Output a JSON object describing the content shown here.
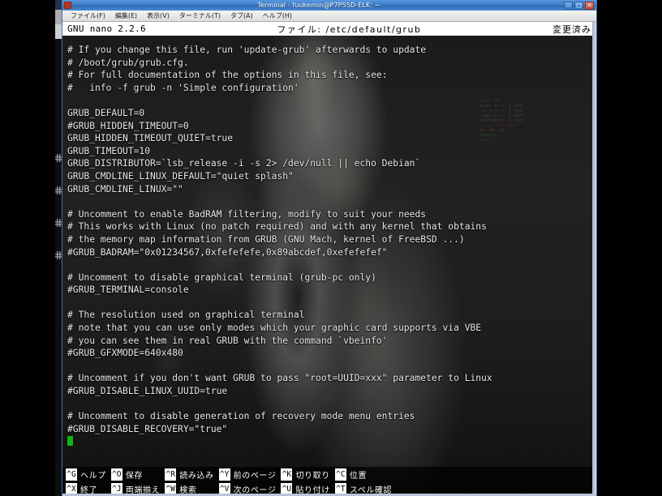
{
  "window": {
    "title": "Terminal - fuukemin@P7P55D-ELK: ~",
    "icon": "terminal-icon",
    "buttons": {
      "minimize": "–",
      "maximize": "□",
      "close": "✕"
    }
  },
  "menubar": {
    "items": [
      {
        "label": "ファイル(F)",
        "name": "menu-file"
      },
      {
        "label": "編集(E)",
        "name": "menu-edit"
      },
      {
        "label": "表示(V)",
        "name": "menu-view"
      },
      {
        "label": "ターミナル(T)",
        "name": "menu-terminal"
      },
      {
        "label": "タブ(A)",
        "name": "menu-tab"
      },
      {
        "label": "ヘルプ(H)",
        "name": "menu-help"
      }
    ]
  },
  "nano": {
    "version": "GNU nano 2.2.6",
    "file_label": "ファイル: /etc/default/grub",
    "modified": "変更済み",
    "lines": [
      "# If you change this file, run 'update-grub' afterwards to update",
      "# /boot/grub/grub.cfg.",
      "# For full documentation of the options in this file, see:",
      "#   info -f grub -n 'Simple configuration'",
      "",
      "GRUB_DEFAULT=0",
      "#GRUB_HIDDEN_TIMEOUT=0",
      "GRUB_HIDDEN_TIMEOUT_QUIET=true",
      "GRUB_TIMEOUT=10",
      "GRUB_DISTRIBUTOR=`lsb_release -i -s 2> /dev/null || echo Debian`",
      "GRUB_CMDLINE_LINUX_DEFAULT=\"quiet splash\"",
      "GRUB_CMDLINE_LINUX=\"\"",
      "",
      "# Uncomment to enable BadRAM filtering, modify to suit your needs",
      "# This works with Linux (no patch required) and with any kernel that obtains",
      "# the memory map information from GRUB (GNU Mach, kernel of FreeBSD ...)",
      "#GRUB_BADRAM=\"0x01234567,0xfefefefe,0x89abcdef,0xefefefef\"",
      "",
      "# Uncomment to disable graphical terminal (grub-pc only)",
      "#GRUB_TERMINAL=console",
      "",
      "# The resolution used on graphical terminal",
      "# note that you can use only modes which your graphic card supports via VBE",
      "# you can see them in real GRUB with the command `vbeinfo'",
      "#GRUB_GFXMODE=640x480",
      "",
      "# Uncomment if you don't want GRUB to pass \"root=UUID=xxx\" parameter to Linux",
      "#GRUB_DISABLE_LINUX_UUID=true",
      "",
      "# Uncomment to disable generation of recovery mode menu entries",
      "#GRUB_DISABLE_RECOVERY=\"true\""
    ],
    "cursor_line_index": 30,
    "cursor_color": "#17b317"
  },
  "shortcuts": {
    "columns": [
      {
        "rows": [
          {
            "key": "^G",
            "label": "ヘルプ",
            "name": "shortcut-help"
          },
          {
            "key": "^X",
            "label": "終了",
            "name": "shortcut-exit"
          }
        ]
      },
      {
        "rows": [
          {
            "key": "^O",
            "label": "保存",
            "name": "shortcut-save"
          },
          {
            "key": "^J",
            "label": "両端揃え",
            "name": "shortcut-justify"
          }
        ]
      },
      {
        "rows": [
          {
            "key": "^R",
            "label": "読み込み",
            "name": "shortcut-read-file"
          },
          {
            "key": "^W",
            "label": "検索",
            "name": "shortcut-search"
          }
        ]
      },
      {
        "rows": [
          {
            "key": "^Y",
            "label": "前のページ",
            "name": "shortcut-prev-page"
          },
          {
            "key": "^V",
            "label": "次のページ",
            "name": "shortcut-next-page"
          }
        ]
      },
      {
        "rows": [
          {
            "key": "^K",
            "label": "切り取り",
            "name": "shortcut-cut"
          },
          {
            "key": "^U",
            "label": "貼り付け",
            "name": "shortcut-paste"
          }
        ]
      },
      {
        "rows": [
          {
            "key": "^C",
            "label": "位置",
            "name": "shortcut-cur-pos"
          },
          {
            "key": "^T",
            "label": "スペル確認",
            "name": "shortcut-spell"
          }
        ]
      }
    ]
  },
  "ghost_session": {
    "lines": [
      "total 48",
      "drwxr-xr-x  2 root",
      "-rw-r--r--  1 root",
      "-rwxr-xr-x  1 root",
      "lrwxrwxrwx  1 root",
      "",
      "error: not found",
      "",
      "ok  ok  ok",
      "running...",
      "done"
    ]
  },
  "colors": {
    "titlebar": "#3e7cc4",
    "menubar": "#e8e7e5",
    "nano_header_bg": "#ffffff",
    "terminal_text": "#e8e8e8",
    "cursor": "#17b317",
    "desktop": "#000000"
  }
}
